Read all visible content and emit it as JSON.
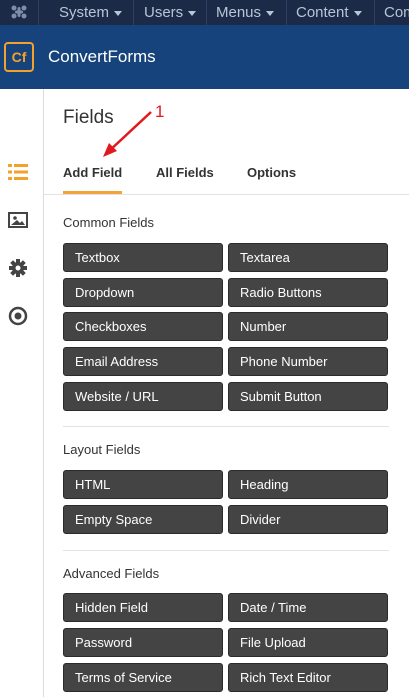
{
  "top_menu": {
    "items": [
      "System",
      "Users",
      "Menus",
      "Content",
      "Com"
    ]
  },
  "brand": {
    "logo_text": "Cf",
    "name": "ConvertForms"
  },
  "sidebar": {
    "icons": [
      "list-icon",
      "image-icon",
      "gear-icon",
      "target-icon"
    ]
  },
  "main": {
    "title": "Fields",
    "tabs": [
      "Add Field",
      "All Fields",
      "Options"
    ],
    "annotation_number": "1"
  },
  "sections": [
    {
      "title": "Common Fields",
      "buttons": [
        "Textbox",
        "Textarea",
        "Dropdown",
        "Radio Buttons",
        "Checkboxes",
        "Number",
        "Email Address",
        "Phone Number",
        "Website / URL",
        "Submit Button"
      ]
    },
    {
      "title": "Layout Fields",
      "buttons": [
        "HTML",
        "Heading",
        "Empty Space",
        "Divider"
      ]
    },
    {
      "title": "Advanced Fields",
      "buttons": [
        "Hidden Field",
        "Date / Time",
        "Password",
        "File Upload",
        "Terms of Service",
        "Rich Text Editor"
      ]
    }
  ],
  "colors": {
    "topbar": "#1b2a47",
    "brandbar": "#16437b",
    "accent": "#f2a22c",
    "active_tab_underline": "#f0a43a",
    "button_bg": "#444444",
    "annotation": "#e0191d"
  }
}
